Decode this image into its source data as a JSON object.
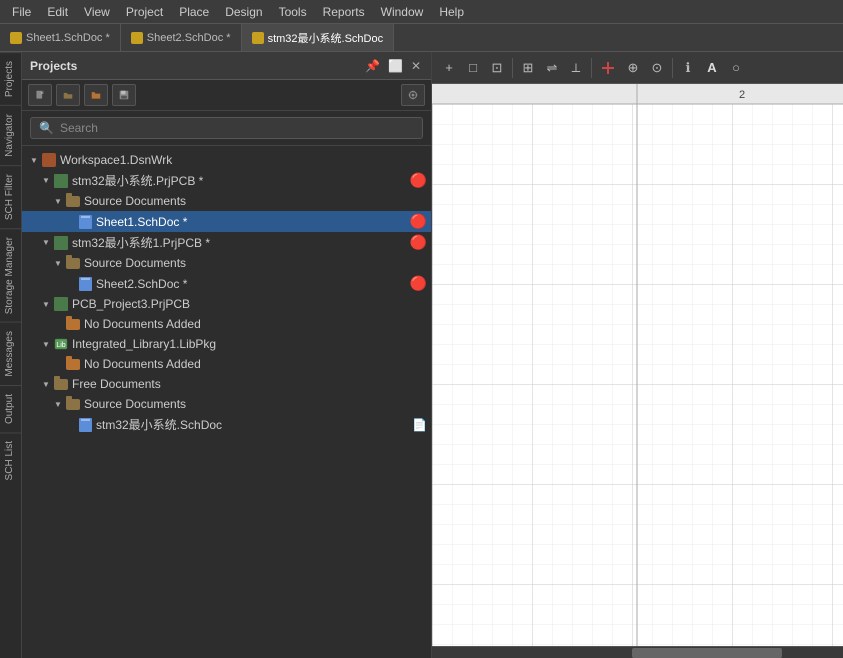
{
  "menubar": {
    "items": [
      "File",
      "Edit",
      "View",
      "Project",
      "Place",
      "Design",
      "Tools",
      "Reports",
      "Window",
      "Help"
    ]
  },
  "tabs": [
    {
      "label": "Sheet1.SchDoc *",
      "icon_color": "#c8a020",
      "active": false
    },
    {
      "label": "Sheet2.SchDoc *",
      "icon_color": "#c8a020",
      "active": false
    },
    {
      "label": "stm32最小系统.SchDoc",
      "icon_color": "#c8a020",
      "active": true
    }
  ],
  "vtabs": [
    "Projects",
    "Navigator",
    "SCH Filter",
    "Storage Manager",
    "Messages",
    "Output",
    "SCH List"
  ],
  "panel": {
    "title": "Projects",
    "toolbar_buttons": [
      "new",
      "open",
      "folder",
      "save",
      "settings"
    ],
    "search_placeholder": "Search",
    "tree": [
      {
        "id": "workspace",
        "label": "Workspace1.DsnWrk",
        "level": 0,
        "type": "workspace",
        "arrow": "▼"
      },
      {
        "id": "proj1",
        "label": "stm32最小系统.PrjPCB *",
        "level": 1,
        "type": "project",
        "arrow": "▼",
        "modified": true
      },
      {
        "id": "src1",
        "label": "Source Documents",
        "level": 2,
        "type": "folder",
        "arrow": "▼"
      },
      {
        "id": "sheet1",
        "label": "Sheet1.SchDoc *",
        "level": 3,
        "type": "schdoc",
        "selected": true,
        "modified": true
      },
      {
        "id": "proj2",
        "label": "stm32最小系统1.PrjPCB *",
        "level": 1,
        "type": "project",
        "arrow": "▼",
        "modified": true
      },
      {
        "id": "src2",
        "label": "Source Documents",
        "level": 2,
        "type": "folder",
        "arrow": "▼"
      },
      {
        "id": "sheet2",
        "label": "Sheet2.SchDoc *",
        "level": 3,
        "type": "schdoc",
        "modified": true
      },
      {
        "id": "proj3",
        "label": "PCB_Project3.PrjPCB",
        "level": 1,
        "type": "project",
        "arrow": "▼"
      },
      {
        "id": "noDocs1",
        "label": "No Documents Added",
        "level": 2,
        "type": "empty"
      },
      {
        "id": "lib1",
        "label": "Integrated_Library1.LibPkg",
        "level": 1,
        "type": "libpkg",
        "arrow": "▼"
      },
      {
        "id": "noDocs2",
        "label": "No Documents Added",
        "level": 2,
        "type": "empty"
      },
      {
        "id": "free",
        "label": "Free Documents",
        "level": 1,
        "type": "folder_group",
        "arrow": "▼"
      },
      {
        "id": "srcFree",
        "label": "Source Documents",
        "level": 2,
        "type": "folder",
        "arrow": "▼"
      },
      {
        "id": "sheetFree",
        "label": "stm32最小系统.SchDoc",
        "level": 3,
        "type": "schdoc"
      }
    ]
  },
  "canvas": {
    "column_number": "2",
    "toolbar_icons": [
      "+",
      "□",
      "⊡",
      "⊞",
      "⇌",
      "⟂",
      "✚",
      "⊕",
      "⊙",
      "ℹ",
      "A",
      "○"
    ]
  }
}
